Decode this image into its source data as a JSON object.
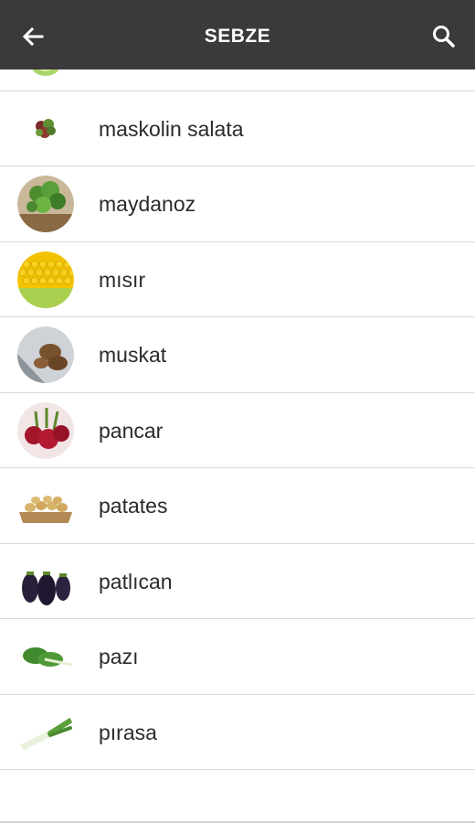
{
  "app_bar": {
    "title": "SEBZE",
    "back_icon": "arrow-left-icon",
    "search_icon": "search-icon",
    "background": "#3a3a3d"
  },
  "items": [
    {
      "label": "",
      "image": "cabbage-thumbnail"
    },
    {
      "label": "maskolin salata",
      "image": "mixed-salad-thumbnail"
    },
    {
      "label": "maydanoz",
      "image": "parsley-thumbnail"
    },
    {
      "label": "mısır",
      "image": "corn-thumbnail"
    },
    {
      "label": "muskat",
      "image": "nutmeg-thumbnail"
    },
    {
      "label": "pancar",
      "image": "beetroot-thumbnail"
    },
    {
      "label": "patates",
      "image": "potatoes-thumbnail"
    },
    {
      "label": "patlıcan",
      "image": "eggplant-thumbnail"
    },
    {
      "label": "pazı",
      "image": "chard-thumbnail"
    },
    {
      "label": "pırasa",
      "image": "leek-thumbnail"
    }
  ]
}
